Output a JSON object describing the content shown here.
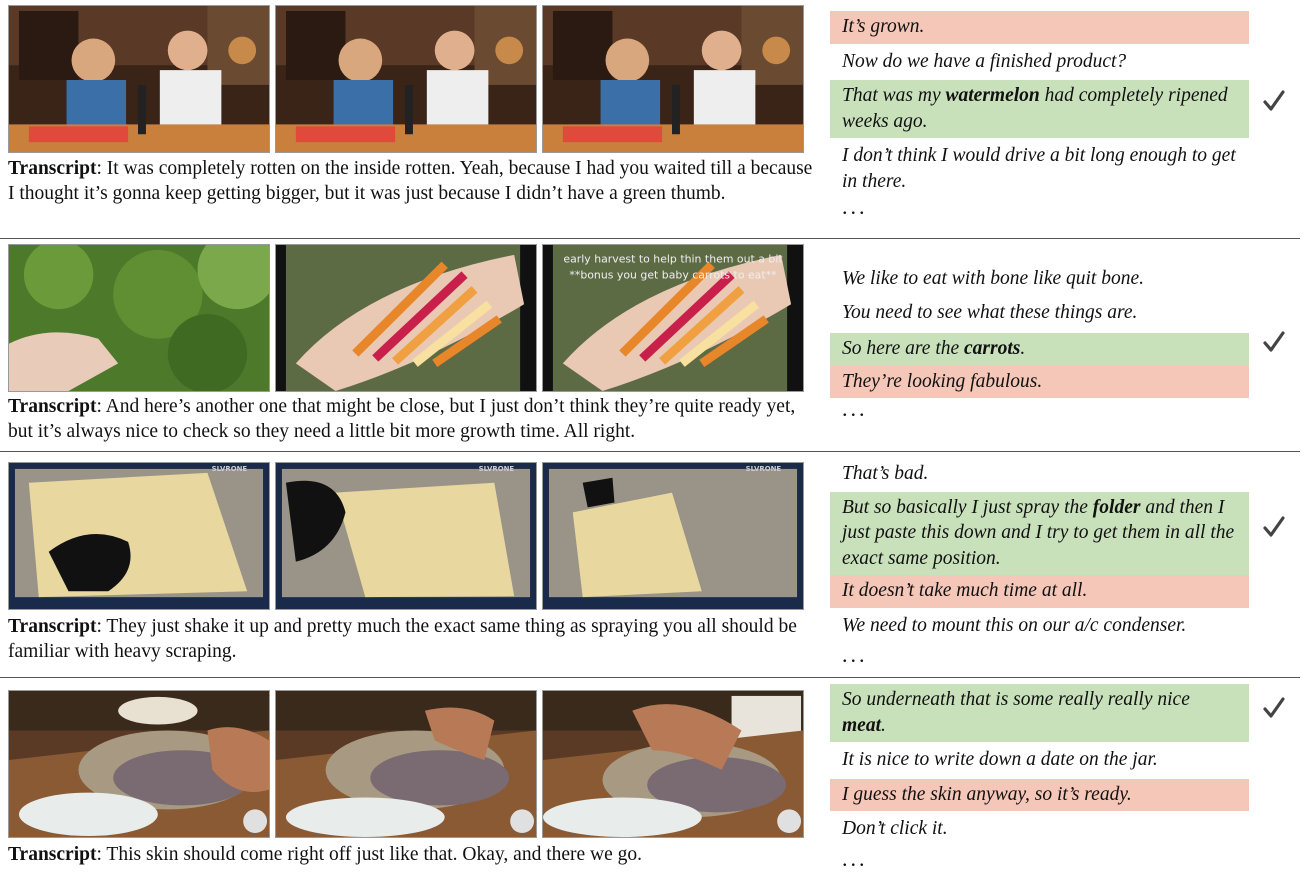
{
  "transcript_label": "Transcript",
  "rows": [
    {
      "transcript": ": It was completely rotten on the inside rotten. Yeah, because I had you waited till a because I thought it’s gonna keep getting bigger, but it was just because I didn’t have a green thumb.",
      "captions": [
        {
          "pre": "It’s grown.",
          "bold": "",
          "post": "",
          "status": "red"
        },
        {
          "pre": "Now do we have a finished product?",
          "bold": "",
          "post": "",
          "status": "none"
        },
        {
          "pre": "That was my ",
          "bold": "watermelon",
          "post": " had completely ripened weeks ago.",
          "status": "green"
        },
        {
          "pre": "I don’t think I would drive a bit long enough to get in there.",
          "bold": "",
          "post": "",
          "status": "none"
        }
      ],
      "ellipsis": "...",
      "check_icon": "checkmark-icon"
    },
    {
      "transcript": ":  And here’s another one that might be close, but I just don’t think they’re quite ready yet, but it’s always nice to check so they need a little bit more growth time. All right.",
      "overlay_text": [
        "early harvest to help thin them out a bit",
        "**bonus you get baby carrots to eat**"
      ],
      "captions": [
        {
          "pre": "We like to eat with bone like quit bone.",
          "bold": "",
          "post": "",
          "status": "none"
        },
        {
          "pre": "You need to see what these things are.",
          "bold": "",
          "post": "",
          "status": "none"
        },
        {
          "pre": "So here are the ",
          "bold": "carrots",
          "post": ".",
          "status": "green"
        },
        {
          "pre": "They’re looking fabulous.",
          "bold": "",
          "post": "",
          "status": "red"
        }
      ],
      "ellipsis": "...",
      "check_icon": "checkmark-icon"
    },
    {
      "transcript": ":  They just shake it up and pretty much the exact same thing as spraying you all should be familiar with heavy scraping.",
      "watermark": "SLVRONE",
      "captions": [
        {
          "pre": "That’s bad.",
          "bold": "",
          "post": "",
          "status": "none"
        },
        {
          "pre": "But so basically I just spray the ",
          "bold": "folder",
          "post": " and then I just paste this down and I try to get them in all the exact same position.",
          "status": "green"
        },
        {
          "pre": "It doesn’t take much time at all.",
          "bold": "",
          "post": "",
          "status": "red"
        },
        {
          "pre": "We need to mount this on our a/c condenser.",
          "bold": "",
          "post": "",
          "status": "none"
        }
      ],
      "ellipsis": "...",
      "check_icon": "checkmark-icon"
    },
    {
      "transcript": ": This skin should come right off just like that. Okay, and there we go.",
      "captions": [
        {
          "pre": "So underneath that is some really really nice ",
          "bold": "meat",
          "post": ".",
          "status": "green"
        },
        {
          "pre": "It is nice to write down a date on the jar.",
          "bold": "",
          "post": "",
          "status": "none"
        },
        {
          "pre": "I guess the skin anyway, so it’s ready.",
          "bold": "",
          "post": "",
          "status": "red"
        },
        {
          "pre": "Don’t click it.",
          "bold": "",
          "post": "",
          "status": "none"
        }
      ],
      "ellipsis": "...",
      "check_icon": "checkmark-icon"
    }
  ]
}
